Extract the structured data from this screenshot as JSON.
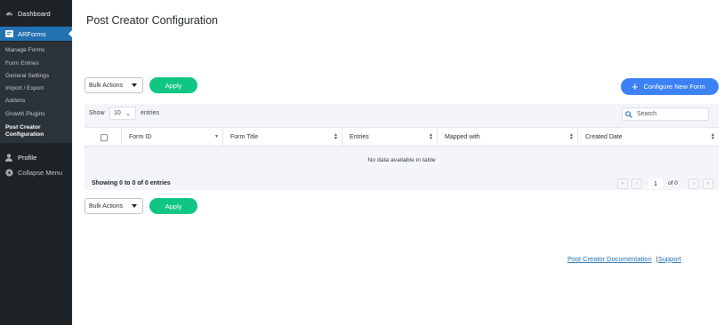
{
  "sidebar": {
    "dashboard": "Dashboard",
    "arforms": "ARForms",
    "submenu": [
      "Manage Forms",
      "Form Entries",
      "General Settings",
      "Import / Export",
      "Addons",
      "Growth Plugins"
    ],
    "current_line1": "Post Creator",
    "current_line2": "Configuration",
    "profile": "Profile",
    "collapse": "Collapse Menu"
  },
  "page": {
    "title": "Post Creator Configuration"
  },
  "toolbar": {
    "bulk_actions": "Bulk Actions",
    "apply": "Apply",
    "configure": "Configure New Form"
  },
  "table": {
    "show": "Show",
    "page_length": "10",
    "entries": "entries",
    "search_placeholder": "Search",
    "columns": [
      "Form ID",
      "Form Title",
      "Entries",
      "Mapped with",
      "Created Date"
    ],
    "empty": "No data available in table",
    "info": "Showing 0 to 0 of 0 entries",
    "page": "1",
    "of": "of 0"
  },
  "footer": {
    "docs": "Post Creator Documentation",
    "support": "Support",
    "separator": "|"
  },
  "colors": {
    "sidebar_bg": "#1d2327",
    "active_menu": "#2271b1",
    "apply_green": "#11c683",
    "configure_blue": "#3c82f6"
  }
}
